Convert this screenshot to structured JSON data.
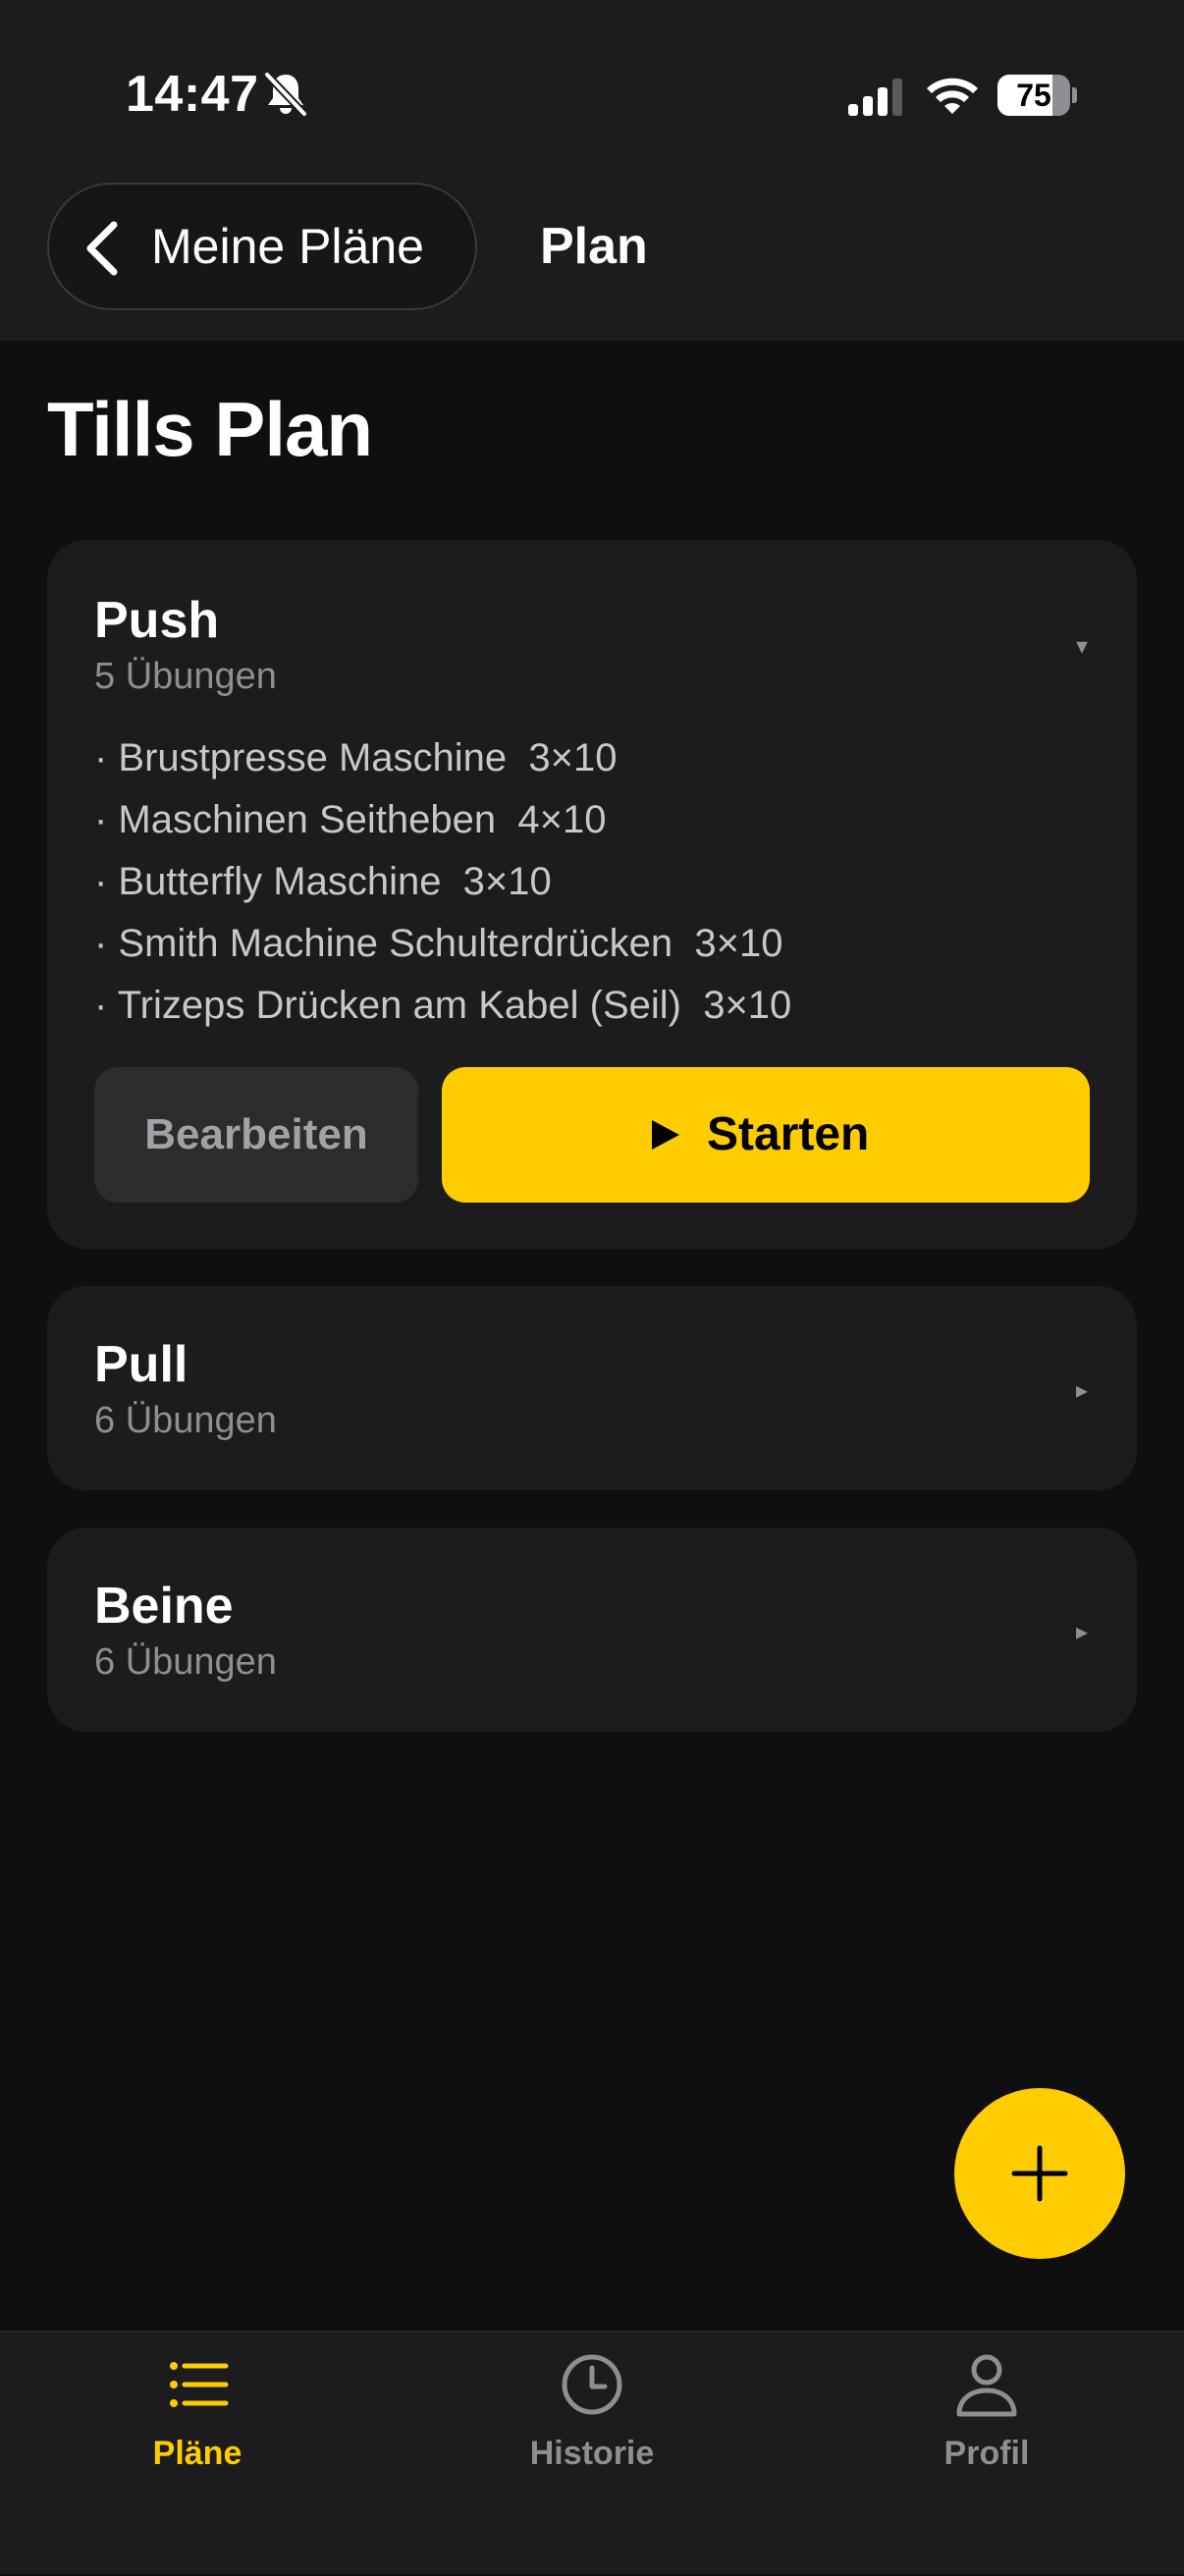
{
  "status_bar": {
    "time": "14:47",
    "battery_percent": "75",
    "battery_level": 0.75
  },
  "nav": {
    "back_label": "Meine Pläne",
    "title": "Plan"
  },
  "page": {
    "title": "Tills Plan"
  },
  "plans": [
    {
      "name": "Push",
      "count_label": "5 Übungen",
      "expanded": true,
      "arrow": "▾",
      "exercises": [
        "· Brustpresse Maschine  3×10",
        "· Maschinen Seitheben  4×10",
        "· Butterfly Maschine  3×10",
        "· Smith Machine Schulterdrücken  3×10",
        "· Trizeps Drücken am Kabel (Seil)  3×10"
      ],
      "edit_label": "Bearbeiten",
      "start_label": "Starten"
    },
    {
      "name": "Pull",
      "count_label": "6 Übungen",
      "expanded": false,
      "arrow": "▸"
    },
    {
      "name": "Beine",
      "count_label": "6 Übungen",
      "expanded": false,
      "arrow": "▸"
    }
  ],
  "tabs": [
    {
      "label": "Pläne",
      "icon": "list-icon",
      "active": true
    },
    {
      "label": "Historie",
      "icon": "clock-icon",
      "active": false
    },
    {
      "label": "Profil",
      "icon": "person-icon",
      "active": false
    }
  ],
  "colors": {
    "accent": "#ffcc00",
    "background": "#0f0f10",
    "card": "#1c1c1e",
    "inactive": "#8e8e93"
  }
}
